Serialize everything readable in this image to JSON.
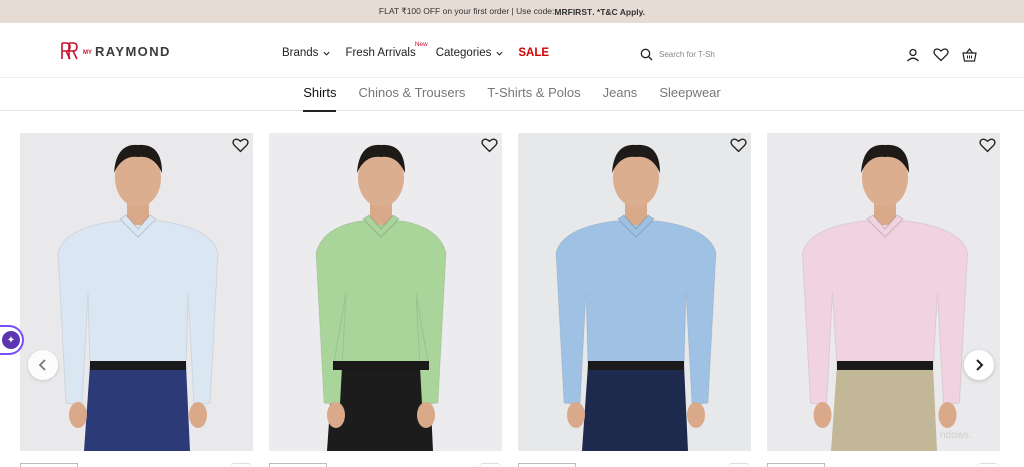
{
  "promo": {
    "text_before": "FLAT ₹100 OFF on your first order | Use code: ",
    "code": "MRFIRST",
    "text_after": ". *T&C Apply."
  },
  "header": {
    "logo_prefix": "MY",
    "logo_name": "RAYMOND",
    "brand_color": "#c8102e",
    "nav": {
      "brands": "Brands",
      "fresh_arrivals": "Fresh Arrivals",
      "new_badge": "New",
      "categories": "Categories",
      "sale": "SALE"
    },
    "search": {
      "placeholder": "Search for T-Sh"
    }
  },
  "tabs": [
    {
      "label": "Shirts",
      "active": true
    },
    {
      "label": "Chinos & Trousers",
      "active": false
    },
    {
      "label": "T-Shirts & Polos",
      "active": false
    },
    {
      "label": "Jeans",
      "active": false
    },
    {
      "label": "Sleepwear",
      "active": false
    }
  ],
  "products": [
    {
      "shirt_color": "#dbe6f3",
      "pant_color": "#2d3a78",
      "bg_color": "#e9e9eb"
    },
    {
      "shirt_color": "#a9d49a",
      "pant_color": "#1c1c1c",
      "bg_color": "#ececee"
    },
    {
      "shirt_color": "#9fc1e4",
      "pant_color": "#1e2a4d",
      "bg_color": "#e7e8ea"
    },
    {
      "shirt_color": "#f1d2df",
      "pant_color": "#c2b796",
      "bg_color": "#eaeaec"
    }
  ],
  "watermark": "ndows."
}
